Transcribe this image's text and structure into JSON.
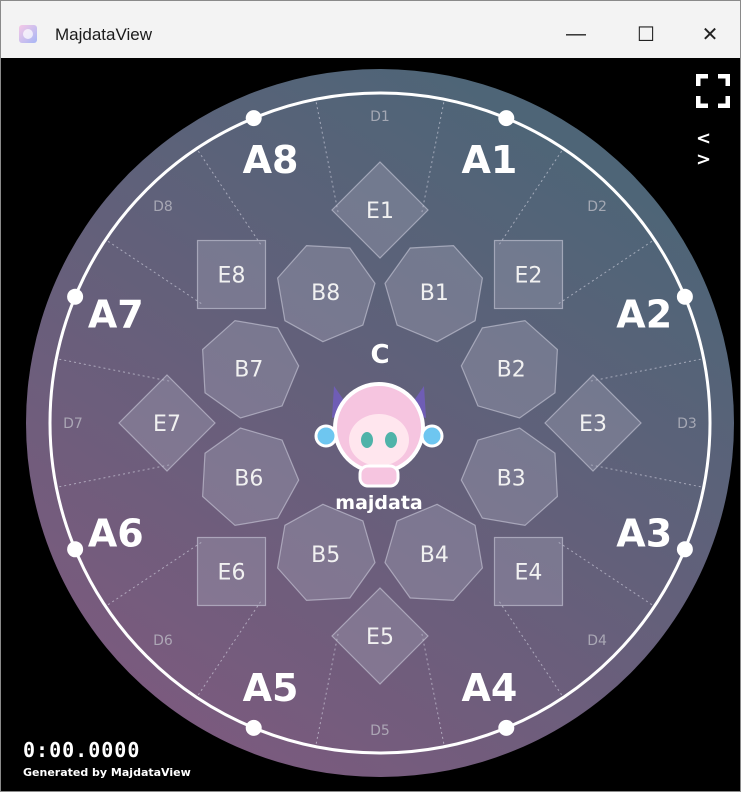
{
  "window": {
    "title": "MajdataView",
    "controls": {
      "minimize": "—",
      "maximize": "☐",
      "close": "✕"
    }
  },
  "board": {
    "center_label": "C",
    "logo_text": "majdata",
    "a_labels": [
      "A1",
      "A2",
      "A3",
      "A4",
      "A5",
      "A6",
      "A7",
      "A8"
    ],
    "b_labels": [
      "B1",
      "B2",
      "B3",
      "B4",
      "B5",
      "B6",
      "B7",
      "B8"
    ],
    "e_labels": [
      "E1",
      "E2",
      "E3",
      "E4",
      "E5",
      "E6",
      "E7",
      "E8"
    ],
    "d_labels": [
      "D1",
      "D2",
      "D3",
      "D4",
      "D5",
      "D6",
      "D7",
      "D8"
    ]
  },
  "hud": {
    "time": "0:00.0000",
    "credit": "Generated by MajdataView",
    "nav": "< >"
  },
  "colors": {
    "bg_top": "#4e6577",
    "bg_bottom": "#7c5a7e",
    "zone_fill": "#9a9aae",
    "ring": "#ffffff"
  }
}
